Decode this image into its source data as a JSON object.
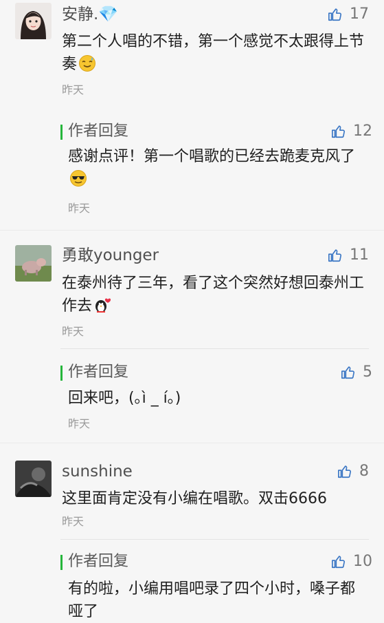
{
  "comments": [
    {
      "name": "安静.💎",
      "likes": "17",
      "text": "第二个人唱的不错，第一个感觉不太跟得上节奏",
      "time": "昨天",
      "reply": {
        "label": "作者回复",
        "likes": "12",
        "text": "感谢点评！第一个唱歌的已经去跪麦克风了",
        "time": "昨天"
      }
    },
    {
      "name": "勇敢younger",
      "likes": "11",
      "text": "在泰州待了三年，看了这个突然好想回泰州工作去",
      "time": "昨天",
      "reply": {
        "label": "作者回复",
        "likes": "5",
        "text": "回来吧，(｡ì _ í｡)",
        "time": "昨天"
      }
    },
    {
      "name": "sunshine",
      "likes": "8",
      "text": "这里面肯定没有小编在唱歌。双击6666",
      "time": "昨天",
      "reply": {
        "label": "作者回复",
        "likes": "10",
        "text": "有的啦，小编用唱吧录了四个小时，嗓子都哑了",
        "time": ""
      }
    }
  ]
}
